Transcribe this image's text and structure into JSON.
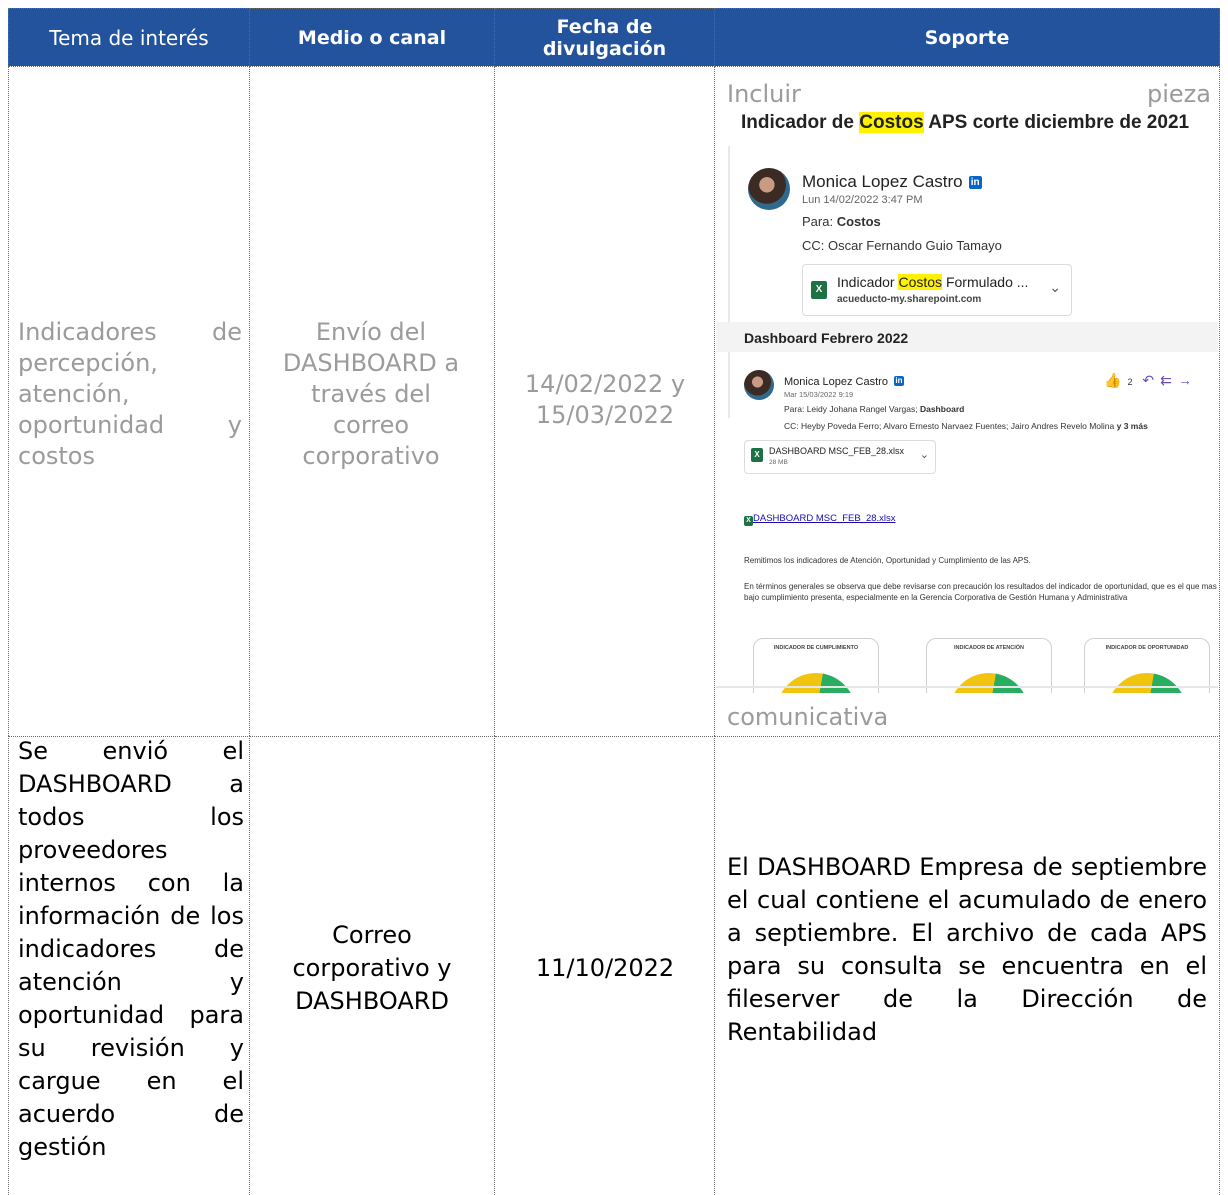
{
  "table": {
    "headers": [
      "Tema de interés",
      "Medio o canal",
      "Fecha de divulgación",
      "Soporte"
    ],
    "row1": {
      "tema": "Indicadores de percepción, atención, oportunidad y costos",
      "medio": "Envío del DASHBOARD a través del correo corporativo",
      "fecha": "14/02/2022 y 15/03/2022",
      "soporte_top_left": "Incluir",
      "soporte_top_right": "pieza",
      "soporte_bottom": "comunicativa"
    },
    "row2": {
      "tema": "Se envió el DASHBOARD a todos los proveedores internos con la información de los indicadores de atención y oportunidad para su revisión y cargue en el acuerdo de gestión",
      "medio": "Correo corporativo y DASHBOARD",
      "fecha": "11/10/2022",
      "soporte": "El DASHBOARD Empresa de septiembre el cual contiene el acumulado de enero a septiembre. El archivo de cada APS para su consulta se encuentra en el fileserver de la Dirección de Rentabilidad"
    }
  },
  "email1": {
    "subject_pre": "Indicador de ",
    "subject_hl": "Costos",
    "subject_post": " APS corte diciembre de 2021",
    "sender": "Monica Lopez Castro",
    "date": "Lun 14/02/2022 3:47 PM",
    "to_label": "Para:",
    "to": "Costos",
    "cc_label": "CC:",
    "cc": "Oscar Fernando Guio Tamayo",
    "attach_pre": "Indicador ",
    "attach_hl": "Costos",
    "attach_post": " Formulado ...",
    "attach_host": "acueducto-my.sharepoint.com"
  },
  "email2": {
    "subject": "Dashboard Febrero 2022",
    "sender": "Monica Lopez Castro",
    "date": "Mar 15/03/2022 9:19",
    "likes": "2",
    "to_label": "Para:",
    "to_name": "Leidy Johana Rangel Vargas;",
    "to_bold": "Dashboard",
    "cc_label": "CC:",
    "cc": "Heyby Poveda Ferro;  Alvaro Ernesto Narvaez Fuentes;  Jairo Andres Revelo Molina",
    "cc_more": "y 3 más",
    "attach_name": "DASHBOARD MSC_FEB_28.xlsx",
    "attach_size": "28 MB",
    "link": "DASHBOARD MSC_FEB_28.xlsx",
    "para1": "Remitimos los indicadores de Atención, Oportunidad y Cumplimiento de las APS.",
    "para2": "En términos generales se observa que debe revisarse con precaución los resultados del indicador de oportunidad, que es el que mas bajo cumplimiento presenta, especialmente en la Gerencia Corporativa de Gestión Humana y Administrativa",
    "gauges": [
      "INDICADOR DE CUMPLIMIENTO",
      "INDICADOR DE ATENCIÓN",
      "INDICADOR DE OPORTUNIDAD"
    ]
  },
  "colors": {
    "header_bg": "#23539d",
    "header_text": "#ffffff",
    "gray_text": "#9b9b9b",
    "highlight": "#fff200"
  }
}
